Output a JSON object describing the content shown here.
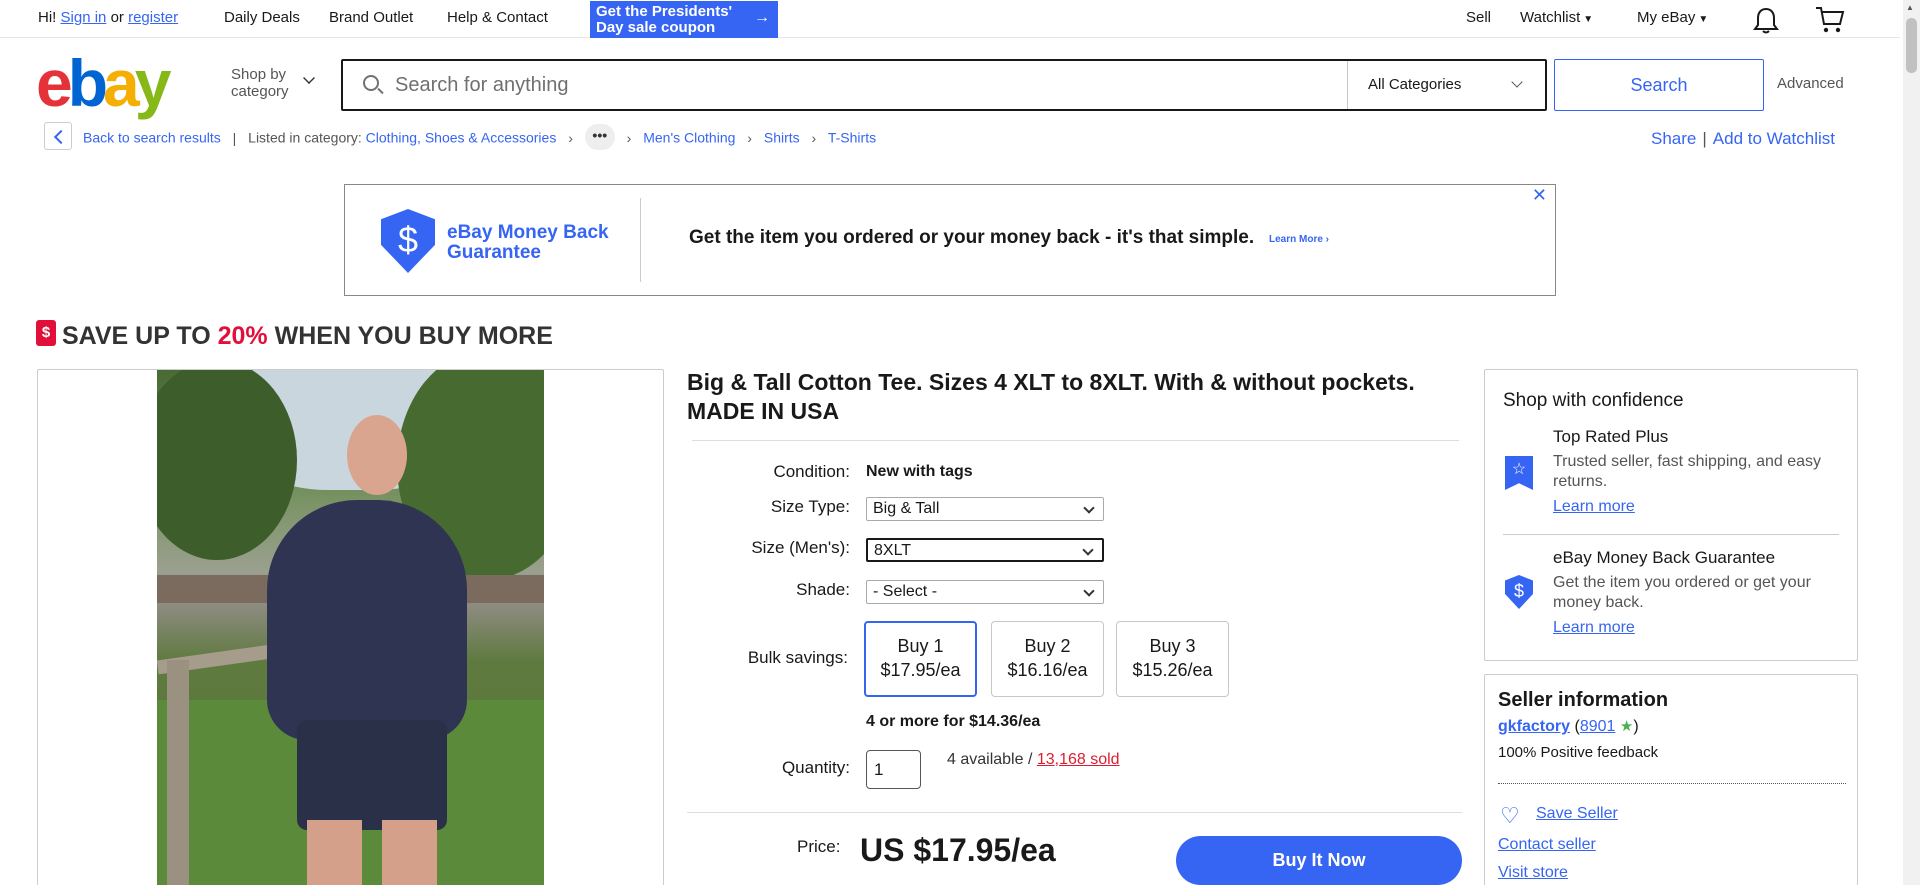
{
  "topbar": {
    "hi": "Hi!",
    "signin": "Sign in",
    "or": "or",
    "register": "register",
    "daily_deals": "Daily Deals",
    "brand_outlet": "Brand Outlet",
    "help": "Help & Contact",
    "promo_line1": "Get the Presidents'",
    "promo_line2": "Day sale coupon",
    "sell": "Sell",
    "watchlist": "Watchlist",
    "myebay": "My eBay"
  },
  "header": {
    "logo": [
      "e",
      "b",
      "a",
      "y"
    ],
    "shop_by_line1": "Shop by",
    "shop_by_line2": "category",
    "search_placeholder": "Search for anything",
    "category": "All Categories",
    "search_button": "Search",
    "advanced": "Advanced"
  },
  "breadcrumb": {
    "back": "Back to search results",
    "listed_in": "Listed in category:",
    "items": [
      "Clothing, Shoes & Accessories",
      "Men's Clothing",
      "Shirts",
      "T-Shirts"
    ],
    "dots": "•••",
    "share": "Share",
    "add_watchlist": "Add to Watchlist"
  },
  "banner": {
    "shield_symbol": "$",
    "mbg_line1": "eBay Money Back",
    "mbg_line2": "Guarantee",
    "message": "Get the item you ordered or your money back - it's that simple.",
    "learn_more": "Learn More",
    "close": "✕"
  },
  "save": {
    "tag_symbol": "$",
    "prefix": "SAVE UP TO",
    "percent": "20%",
    "suffix": "WHEN YOU BUY MORE"
  },
  "item": {
    "title": "Big & Tall Cotton Tee. Sizes 4 XLT to 8XLT. With & without pockets. MADE IN USA",
    "condition_label": "Condition:",
    "condition_value": "New with tags",
    "size_type_label": "Size Type:",
    "size_type_value": "Big & Tall",
    "size_label": "Size (Men's):",
    "size_value": "8XLT",
    "shade_label": "Shade:",
    "shade_value": "- Select -",
    "bulk_label": "Bulk savings:",
    "tiers": [
      {
        "qty": "Buy 1",
        "price": "$17.95/ea"
      },
      {
        "qty": "Buy 2",
        "price": "$16.16/ea"
      },
      {
        "qty": "Buy 3",
        "price": "$15.26/ea"
      }
    ],
    "bulk_note": "4 or more for $14.36/ea",
    "quantity_label": "Quantity:",
    "quantity_value": "1",
    "available": "4 available /",
    "sold": "13,168 sold",
    "price_label": "Price:",
    "price": "US $17.95/ea",
    "buy_now": "Buy It Now"
  },
  "confidence": {
    "heading": "Shop with confidence",
    "trp_title": "Top Rated Plus",
    "trp_desc": "Trusted seller, fast shipping, and easy returns.",
    "trp_link": "Learn more",
    "mbg_title": "eBay Money Back Guarantee",
    "mbg_desc": "Get the item you ordered or get your money back.",
    "mbg_link": "Learn more"
  },
  "seller": {
    "heading": "Seller information",
    "name": "gkfactory",
    "feedback_score": "8901",
    "positive": "100% Positive feedback",
    "save_seller": "Save Seller",
    "contact": "Contact seller",
    "visit": "Visit store"
  },
  "colors": {
    "accent": "#3665f3",
    "sale_red": "#e0103a"
  }
}
